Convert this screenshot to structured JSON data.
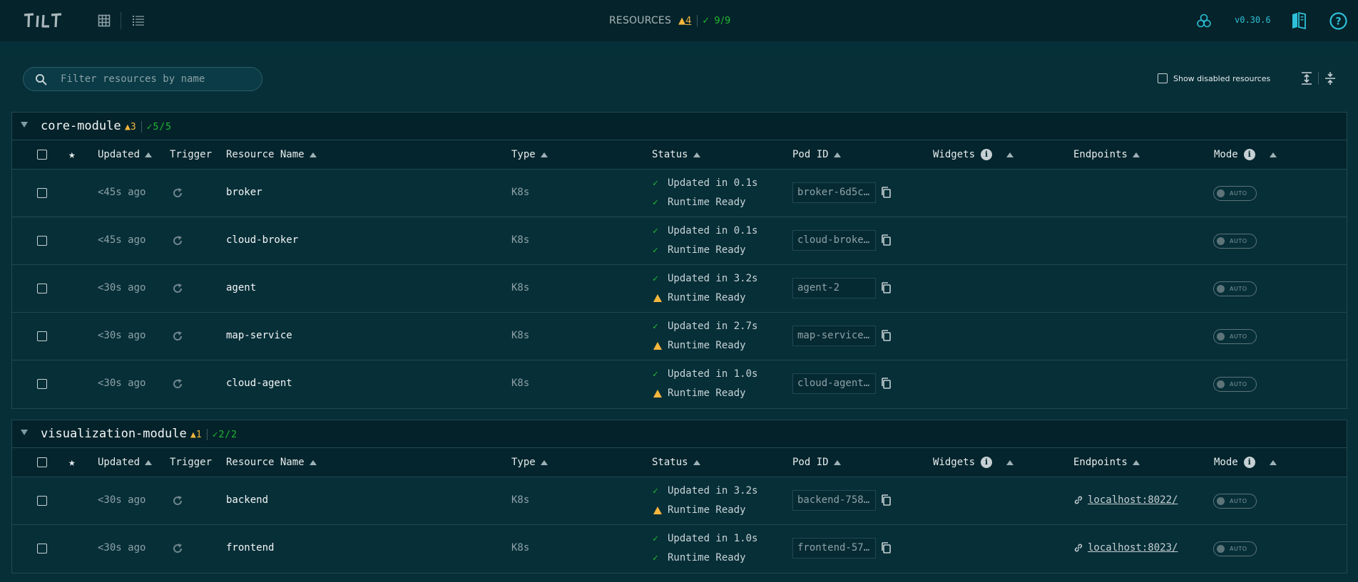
{
  "header": {
    "resources_label": "RESOURCES",
    "warn_symbol": "▲",
    "warn_count": "4",
    "ok_text": "✓ 9/9",
    "version": "v0.30.6"
  },
  "filter": {
    "placeholder": "Filter resources by name"
  },
  "show_disabled_label": "Show disabled resources",
  "columns": {
    "updated": "Updated",
    "trigger": "Trigger",
    "resource_name": "Resource Name",
    "type": "Type",
    "status": "Status",
    "pod_id": "Pod ID",
    "widgets": "Widgets",
    "endpoints": "Endpoints",
    "mode": "Mode"
  },
  "groups": [
    {
      "name": "core-module",
      "warn": "▲3",
      "ok": "✓5/5",
      "rows": [
        {
          "updated": "<45s ago",
          "name": "broker",
          "type": "K8s",
          "status1": "Updated in 0.1s",
          "status1_state": "ok",
          "status2": "Runtime Ready",
          "status2_state": "ok",
          "pod": "broker-6d5c…",
          "endpoint": "",
          "mode": "AUTO"
        },
        {
          "updated": "<45s ago",
          "name": "cloud-broker",
          "type": "K8s",
          "status1": "Updated in 0.1s",
          "status1_state": "ok",
          "status2": "Runtime Ready",
          "status2_state": "ok",
          "pod": "cloud-broke…",
          "endpoint": "",
          "mode": "AUTO"
        },
        {
          "updated": "<30s ago",
          "name": "agent",
          "type": "K8s",
          "status1": "Updated in 3.2s",
          "status1_state": "ok",
          "status2": "Runtime Ready",
          "status2_state": "warn",
          "pod": "agent-2",
          "endpoint": "",
          "mode": "AUTO"
        },
        {
          "updated": "<30s ago",
          "name": "map-service",
          "type": "K8s",
          "status1": "Updated in 2.7s",
          "status1_state": "ok",
          "status2": "Runtime Ready",
          "status2_state": "warn",
          "pod": "map-service…",
          "endpoint": "",
          "mode": "AUTO"
        },
        {
          "updated": "<30s ago",
          "name": "cloud-agent",
          "type": "K8s",
          "status1": "Updated in 1.0s",
          "status1_state": "ok",
          "status2": "Runtime Ready",
          "status2_state": "warn",
          "pod": "cloud-agent…",
          "endpoint": "",
          "mode": "AUTO"
        }
      ]
    },
    {
      "name": "visualization-module",
      "warn": "▲1",
      "ok": "✓2/2",
      "rows": [
        {
          "updated": "<30s ago",
          "name": "backend",
          "type": "K8s",
          "status1": "Updated in 3.2s",
          "status1_state": "ok",
          "status2": "Runtime Ready",
          "status2_state": "warn",
          "pod": "backend-758…",
          "endpoint": "localhost:8022/",
          "mode": "AUTO"
        },
        {
          "updated": "<30s ago",
          "name": "frontend",
          "type": "K8s",
          "status1": "Updated in 1.0s",
          "status1_state": "ok",
          "status2": "Runtime Ready",
          "status2_state": "ok",
          "pod": "frontend-57…",
          "endpoint": "localhost:8023/",
          "mode": "AUTO"
        }
      ]
    }
  ],
  "colors": {
    "background": "#072f38",
    "topbar": "#05232a",
    "ok": "#20ba31",
    "warn": "#f6b73c",
    "accent": "#2ec0d8"
  },
  "icons": [
    "tilt-logo-icon",
    "grid-view-icon",
    "list-view-icon",
    "snapshot-icon",
    "docs-icon",
    "help-icon",
    "search-icon",
    "expand-all-icon",
    "collapse-all-icon",
    "star-icon",
    "trigger-icon",
    "copy-icon",
    "link-icon",
    "info-icon"
  ]
}
